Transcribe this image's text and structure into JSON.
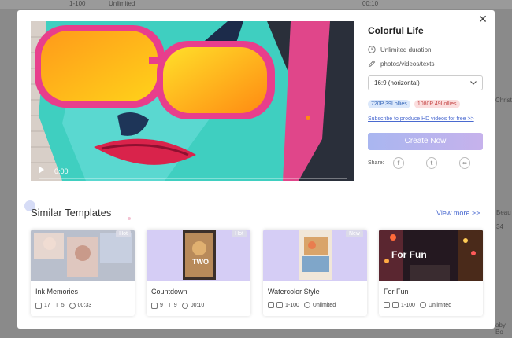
{
  "template": {
    "title": "Colorful Life",
    "duration": "Unlimited duration",
    "media_types": "photos/videos/texts",
    "aspect_ratio": "16:9 (horizontal)",
    "price_720": "720P 39Lollies",
    "price_1080": "1080P 49Lollies",
    "subscribe_text": "Subscribe to produce HD videos for free >>",
    "create_label": "Create Now",
    "share_label": "Share:"
  },
  "video": {
    "time": "0:00"
  },
  "similar": {
    "heading": "Similar Templates",
    "view_more": "View more >>",
    "cards": [
      {
        "name": "Ink Memories",
        "tag": "Hot",
        "meta": [
          "17",
          "5",
          "00:33"
        ]
      },
      {
        "name": "Countdown",
        "tag": "Hot",
        "meta": [
          "9",
          "9",
          "00:10"
        ]
      },
      {
        "name": "Watercolor Style",
        "tag": "New",
        "meta": [
          "1-100",
          "Unlimited"
        ]
      },
      {
        "name": "For Fun",
        "tag": "",
        "meta": [
          "1-100",
          "Unlimited"
        ],
        "thumb_text": "For Fun"
      }
    ]
  },
  "background_text": [
    "1-100",
    "Unlimited",
    "00:10",
    "Christ",
    "Beau",
    "34",
    "aby Bo"
  ],
  "colors": {
    "accent_blue": "#4a6ad0",
    "create_gradient_start": "#a9b6f0",
    "create_gradient_end": "#c6b2ec",
    "badge_blue_bg": "#dbe8fb",
    "badge_pink_bg": "#fbdede"
  },
  "icons": {
    "close": "close-icon",
    "duration": "clock-icon",
    "media": "pencil-icon",
    "dropdown": "chevron-down-icon",
    "share": [
      "facebook-icon",
      "twitter-icon",
      "link-icon"
    ]
  }
}
